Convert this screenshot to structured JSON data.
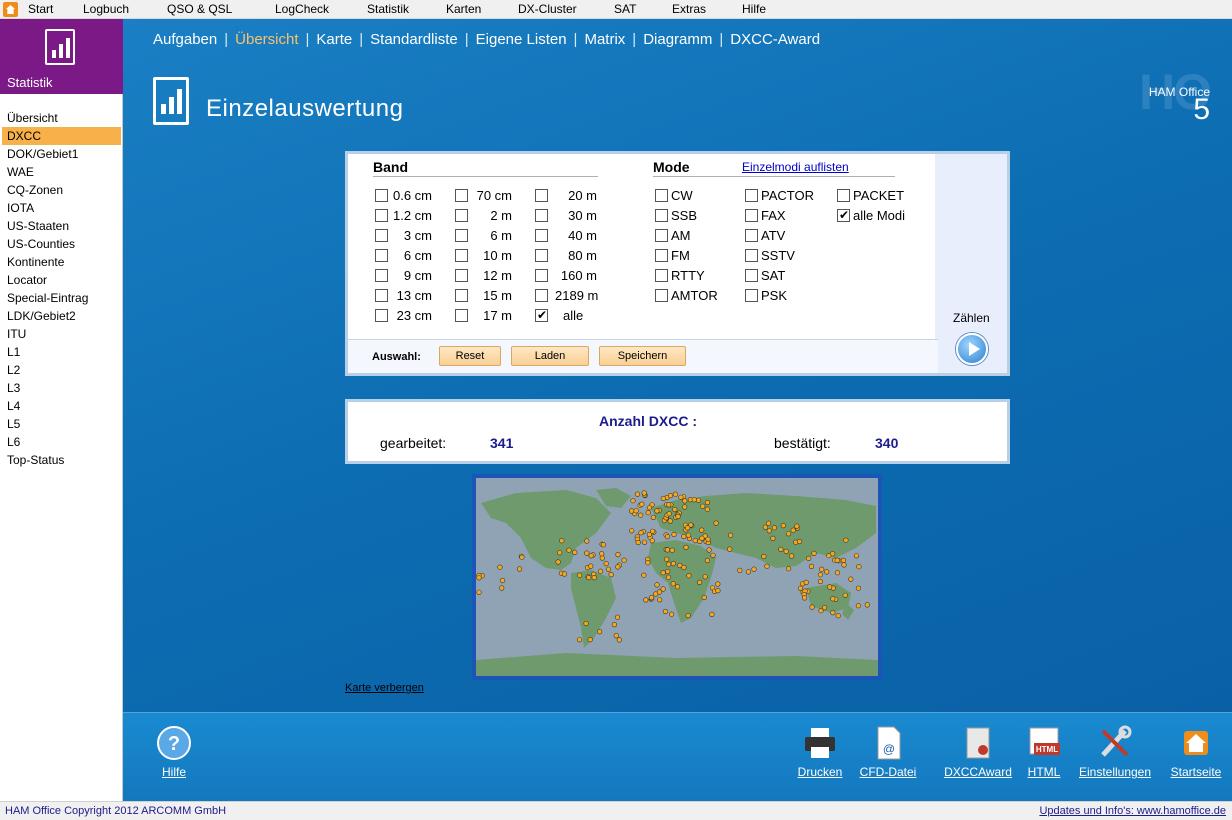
{
  "menu": {
    "items": [
      "Start",
      "Logbuch",
      "QSO & QSL",
      "LogCheck",
      "Statistik",
      "Karten",
      "DX-Cluster",
      "SAT",
      "Extras",
      "Hilfe"
    ]
  },
  "sidebar": {
    "title": "Statistik",
    "items": [
      "Übersicht",
      "DXCC",
      "DOK/Gebiet1",
      "WAE",
      "CQ-Zonen",
      "IOTA",
      "US-Staaten",
      "US-Counties",
      "Kontinente",
      "Locator",
      "Special-Eintrag",
      "LDK/Gebiet2",
      "ITU",
      "L1",
      "L2",
      "L3",
      "L4",
      "L5",
      "L6",
      "Top-Status"
    ],
    "active_index": 1
  },
  "tabs": {
    "items": [
      "Aufgaben",
      "Übersicht",
      "Karte",
      "Standardliste",
      "Eigene Listen",
      "Matrix",
      "Diagramm",
      "DXCC-Award"
    ],
    "active_index": 1
  },
  "page": {
    "title": "Einzelauswertung"
  },
  "brand": {
    "ghost": "HO",
    "name": "HAM Office",
    "version": "5"
  },
  "filter": {
    "band_header": "Band",
    "mode_header": "Mode",
    "mode_link": "Einzelmodi auflisten",
    "bands": [
      {
        "label": "0.6 cm",
        "checked": false
      },
      {
        "label": "70 cm",
        "checked": false
      },
      {
        "label": "20 m",
        "checked": false
      },
      {
        "label": "1.2 cm",
        "checked": false
      },
      {
        "label": "2 m",
        "checked": false
      },
      {
        "label": "30 m",
        "checked": false
      },
      {
        "label": "3 cm",
        "checked": false
      },
      {
        "label": "6 m",
        "checked": false
      },
      {
        "label": "40 m",
        "checked": false
      },
      {
        "label": "6 cm",
        "checked": false
      },
      {
        "label": "10 m",
        "checked": false
      },
      {
        "label": "80 m",
        "checked": false
      },
      {
        "label": "9 cm",
        "checked": false
      },
      {
        "label": "12 m",
        "checked": false
      },
      {
        "label": "160 m",
        "checked": false
      },
      {
        "label": "13 cm",
        "checked": false
      },
      {
        "label": "15 m",
        "checked": false
      },
      {
        "label": "2189 m",
        "checked": false
      },
      {
        "label": "23 cm",
        "checked": false
      },
      {
        "label": "17 m",
        "checked": false
      },
      {
        "label": "alle",
        "checked": true
      }
    ],
    "modes": [
      {
        "label": "CW",
        "checked": false
      },
      {
        "label": "PACTOR",
        "checked": false
      },
      {
        "label": "PACKET",
        "checked": false
      },
      {
        "label": "SSB",
        "checked": false
      },
      {
        "label": "FAX",
        "checked": false
      },
      {
        "label": "alle Modi",
        "checked": true
      },
      {
        "label": "AM",
        "checked": false
      },
      {
        "label": "ATV",
        "checked": false
      },
      {
        "label": "FM",
        "checked": false
      },
      {
        "label": "SSTV",
        "checked": false
      },
      {
        "label": "RTTY",
        "checked": false
      },
      {
        "label": "SAT",
        "checked": false
      },
      {
        "label": "AMTOR",
        "checked": false
      },
      {
        "label": "PSK",
        "checked": false
      }
    ],
    "selection_label": "Auswahl:",
    "buttons": {
      "reset": "Reset",
      "load": "Laden",
      "save": "Speichern"
    },
    "count_label": "Zählen"
  },
  "result": {
    "title": "Anzahl DXCC :",
    "worked_label": "gearbeitet:",
    "worked_value": "341",
    "confirmed_label": "bestätigt:",
    "confirmed_value": "340"
  },
  "map": {
    "hide_link": "Karte verbergen",
    "colors": {
      "ocean": "#8fa3b5",
      "land": "#6e9a6e",
      "dot": "#f6a81c",
      "border": "#1c55b8"
    }
  },
  "toolbar": {
    "help": "Hilfe",
    "print": "Drucken",
    "cfd": "CFD-Datei",
    "dxccaward": "DXCCAward",
    "html": "HTML",
    "settings": "Einstellungen",
    "home": "Startseite",
    "html_icon_text": "HTML"
  },
  "status": {
    "copyright": "HAM Office Copyright 2012 ARCOMM GmbH",
    "link": "Updates und Info's: www.hamoffice.de"
  }
}
